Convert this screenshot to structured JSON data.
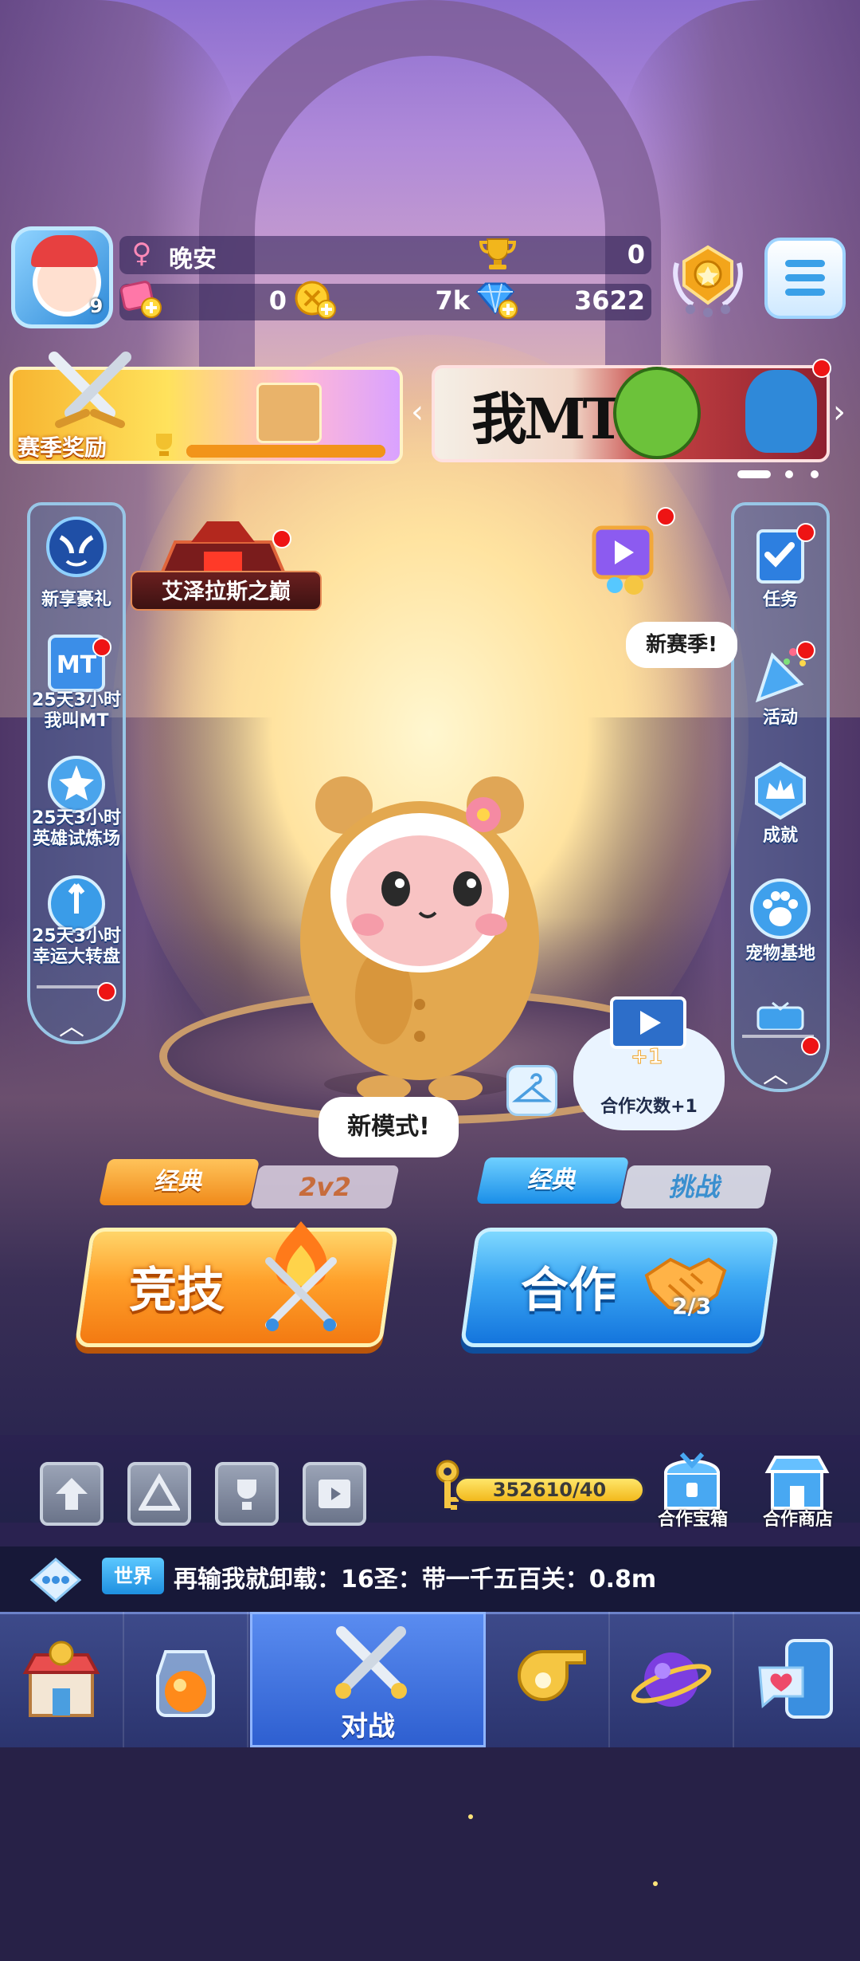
{
  "player": {
    "name": "晚安",
    "level": "9",
    "trophies": "0"
  },
  "resources": {
    "tickets": "0",
    "coins": "7k",
    "gems": "3622"
  },
  "banners": {
    "season_reward": "赛季奖励",
    "event_logo": "我MT"
  },
  "left_sidebar": [
    {
      "label": "新享豪礼"
    },
    {
      "label": "25天3小时\n我叫MT"
    },
    {
      "label": "25天3小时\n英雄试炼场"
    },
    {
      "label": "25天3小时\n幸运大转盘"
    }
  ],
  "right_sidebar": [
    {
      "label": "任务"
    },
    {
      "label": "活动"
    },
    {
      "label": "成就"
    },
    {
      "label": "宠物基地"
    }
  ],
  "featured": {
    "azeroth_label": "艾泽拉斯之巅",
    "new_season_bubble": "新赛季!"
  },
  "coop_bonus": {
    "label": "合作次数+1"
  },
  "new_mode_bubble": "新模式!",
  "modes": {
    "arena": {
      "tab_classic": "经典",
      "tab_2v2": "2v2",
      "label": "竞技"
    },
    "coop": {
      "tab_classic": "经典",
      "tab_challenge": "挑战",
      "label": "合作",
      "count": "2/3"
    }
  },
  "key_progress": "352610/40",
  "shortcuts": {
    "coop_chest": "合作宝箱",
    "coop_shop": "合作商店"
  },
  "chat": {
    "channel": "世界",
    "message": "再输我就卸载：16圣：带一千五百关：0.8m"
  },
  "nav": {
    "battle": "对战"
  },
  "colors": {
    "arena_orange": "#f37a12",
    "coop_blue": "#1475dd",
    "notification_red": "#ee1414"
  }
}
